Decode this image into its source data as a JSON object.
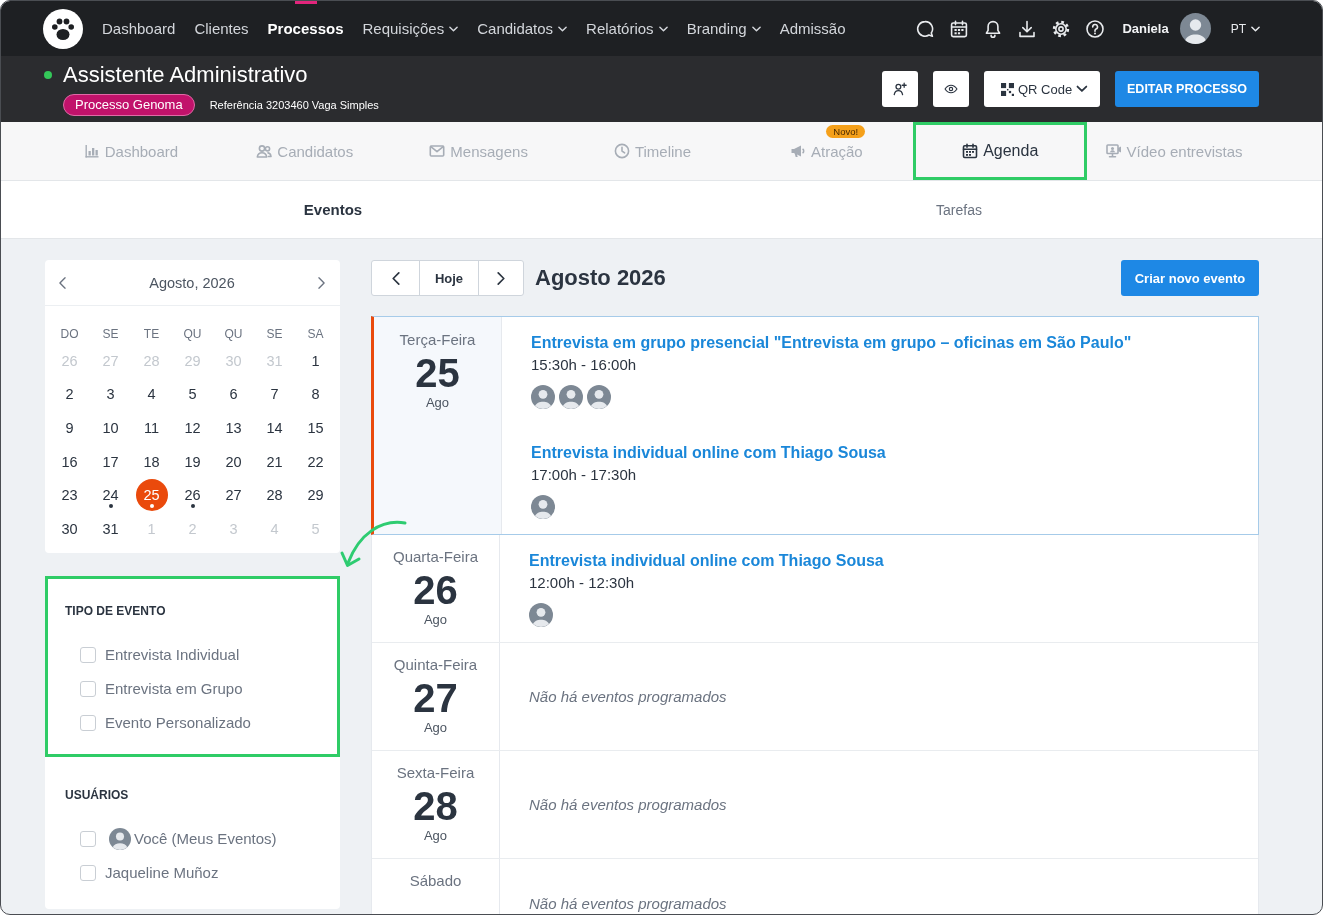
{
  "topbar": {
    "nav": [
      {
        "label": "Dashboard",
        "selected": false,
        "dropdown": false
      },
      {
        "label": "Clientes",
        "selected": false,
        "dropdown": false
      },
      {
        "label": "Processos",
        "selected": true,
        "dropdown": false
      },
      {
        "label": "Requisições",
        "selected": false,
        "dropdown": true
      },
      {
        "label": "Candidatos",
        "selected": false,
        "dropdown": true
      },
      {
        "label": "Relatórios",
        "selected": false,
        "dropdown": true
      },
      {
        "label": "Branding",
        "selected": false,
        "dropdown": true
      },
      {
        "label": "Admissão",
        "selected": false,
        "dropdown": false
      }
    ],
    "user_name": "Daniela",
    "language": "PT"
  },
  "process": {
    "active": true,
    "title": "Assistente Administrativo",
    "tag": "Processo Genoma",
    "reference": "Referência 3203460 Vaga Simples",
    "qr_button": "QR Code",
    "edit_button": "EDITAR PROCESSO"
  },
  "tabs": [
    {
      "label": "Dashboard",
      "selected": false,
      "highlighted": false
    },
    {
      "label": "Candidatos",
      "selected": false,
      "highlighted": false
    },
    {
      "label": "Mensagens",
      "selected": false,
      "highlighted": false
    },
    {
      "label": "Timeline",
      "selected": false,
      "highlighted": false
    },
    {
      "label": "Atração",
      "badge": "Novo!",
      "selected": false,
      "highlighted": false
    },
    {
      "label": "Agenda",
      "selected": true,
      "highlighted": true
    },
    {
      "label": "Vídeo entrevistas",
      "selected": false,
      "highlighted": false
    }
  ],
  "subtabs": [
    {
      "label": "Eventos",
      "selected": true
    },
    {
      "label": "Tarefas",
      "selected": false
    }
  ],
  "mini_calendar": {
    "title": "Agosto, 2026",
    "weekdays": [
      "DO",
      "SE",
      "TE",
      "QU",
      "QU",
      "SE",
      "SA"
    ],
    "days": [
      {
        "label": "26",
        "outside": true,
        "selected": false,
        "has_events": false
      },
      {
        "label": "27",
        "outside": true,
        "selected": false,
        "has_events": false
      },
      {
        "label": "28",
        "outside": true,
        "selected": false,
        "has_events": false
      },
      {
        "label": "29",
        "outside": true,
        "selected": false,
        "has_events": false
      },
      {
        "label": "30",
        "outside": true,
        "selected": false,
        "has_events": false
      },
      {
        "label": "31",
        "outside": true,
        "selected": false,
        "has_events": false
      },
      {
        "label": "1",
        "outside": false,
        "selected": false,
        "has_events": false
      },
      {
        "label": "2",
        "outside": false,
        "selected": false,
        "has_events": false
      },
      {
        "label": "3",
        "outside": false,
        "selected": false,
        "has_events": false
      },
      {
        "label": "4",
        "outside": false,
        "selected": false,
        "has_events": false
      },
      {
        "label": "5",
        "outside": false,
        "selected": false,
        "has_events": false
      },
      {
        "label": "6",
        "outside": false,
        "selected": false,
        "has_events": false
      },
      {
        "label": "7",
        "outside": false,
        "selected": false,
        "has_events": false
      },
      {
        "label": "8",
        "outside": false,
        "selected": false,
        "has_events": false
      },
      {
        "label": "9",
        "outside": false,
        "selected": false,
        "has_events": false
      },
      {
        "label": "10",
        "outside": false,
        "selected": false,
        "has_events": false
      },
      {
        "label": "11",
        "outside": false,
        "selected": false,
        "has_events": false
      },
      {
        "label": "12",
        "outside": false,
        "selected": false,
        "has_events": false
      },
      {
        "label": "13",
        "outside": false,
        "selected": false,
        "has_events": false
      },
      {
        "label": "14",
        "outside": false,
        "selected": false,
        "has_events": false
      },
      {
        "label": "15",
        "outside": false,
        "selected": false,
        "has_events": false
      },
      {
        "label": "16",
        "outside": false,
        "selected": false,
        "has_events": false
      },
      {
        "label": "17",
        "outside": false,
        "selected": false,
        "has_events": false
      },
      {
        "label": "18",
        "outside": false,
        "selected": false,
        "has_events": false
      },
      {
        "label": "19",
        "outside": false,
        "selected": false,
        "has_events": false
      },
      {
        "label": "20",
        "outside": false,
        "selected": false,
        "has_events": false
      },
      {
        "label": "21",
        "outside": false,
        "selected": false,
        "has_events": false
      },
      {
        "label": "22",
        "outside": false,
        "selected": false,
        "has_events": false
      },
      {
        "label": "23",
        "outside": false,
        "selected": false,
        "has_events": false
      },
      {
        "label": "24",
        "outside": false,
        "selected": false,
        "has_events": true
      },
      {
        "label": "25",
        "outside": false,
        "selected": true,
        "has_events": true
      },
      {
        "label": "26",
        "outside": false,
        "selected": false,
        "has_events": true
      },
      {
        "label": "27",
        "outside": false,
        "selected": false,
        "has_events": false
      },
      {
        "label": "28",
        "outside": false,
        "selected": false,
        "has_events": false
      },
      {
        "label": "29",
        "outside": false,
        "selected": false,
        "has_events": false
      },
      {
        "label": "30",
        "outside": false,
        "selected": false,
        "has_events": false
      },
      {
        "label": "31",
        "outside": false,
        "selected": false,
        "has_events": false
      },
      {
        "label": "1",
        "outside": true,
        "selected": false,
        "has_events": false
      },
      {
        "label": "2",
        "outside": true,
        "selected": false,
        "has_events": false
      },
      {
        "label": "3",
        "outside": true,
        "selected": false,
        "has_events": false
      },
      {
        "label": "4",
        "outside": true,
        "selected": false,
        "has_events": false
      },
      {
        "label": "5",
        "outside": true,
        "selected": false,
        "has_events": false
      }
    ]
  },
  "filters": [
    {
      "title": "TIPO DE EVENTO",
      "highlighted": true,
      "options": [
        {
          "label": "Entrevista Individual",
          "checked": false,
          "avatar": false
        },
        {
          "label": "Entrevista em Grupo",
          "checked": false,
          "avatar": false
        },
        {
          "label": "Evento Personalizado",
          "checked": false,
          "avatar": false
        }
      ]
    },
    {
      "title": "USUÁRIOS",
      "highlighted": false,
      "options": [
        {
          "label": "Você (Meus Eventos)",
          "checked": false,
          "avatar": true
        },
        {
          "label": "Jaqueline Muñoz",
          "checked": false,
          "avatar": false
        }
      ]
    }
  ],
  "agenda": {
    "today_button": "Hoje",
    "title": "Agosto 2026",
    "create_button": "Criar novo evento",
    "days": [
      {
        "weekday": "Terça-Feira",
        "day": "25",
        "month": "Ago",
        "today": true,
        "events": [
          {
            "title": "Entrevista em grupo presencial \"Entrevista em grupo – oficinas em São Paulo\"",
            "time": "15:30h - 16:00h",
            "attendees": [
              {
                "kind": "avatar"
              },
              {
                "kind": "avatar"
              },
              {
                "kind": "avatar"
              }
            ]
          },
          {
            "title": "Entrevista individual online com Thiago Sousa",
            "time": "17:00h - 17:30h",
            "attendees": [
              {
                "kind": "avatar"
              }
            ]
          }
        ]
      },
      {
        "weekday": "Quarta-Feira",
        "day": "26",
        "month": "Ago",
        "today": false,
        "events": [
          {
            "title": "Entrevista individual online com Thiago Sousa",
            "time": "12:00h - 12:30h",
            "attendees": [
              {
                "kind": "avatar"
              }
            ]
          }
        ]
      },
      {
        "weekday": "Quinta-Feira",
        "day": "27",
        "month": "Ago",
        "today": false,
        "empty_text": "Não há eventos programados"
      },
      {
        "weekday": "Sexta-Feira",
        "day": "28",
        "month": "Ago",
        "today": false,
        "empty_text": "Não há eventos programados"
      },
      {
        "weekday": "Sábado",
        "today": false,
        "empty_text": "Não há eventos programados"
      }
    ]
  }
}
